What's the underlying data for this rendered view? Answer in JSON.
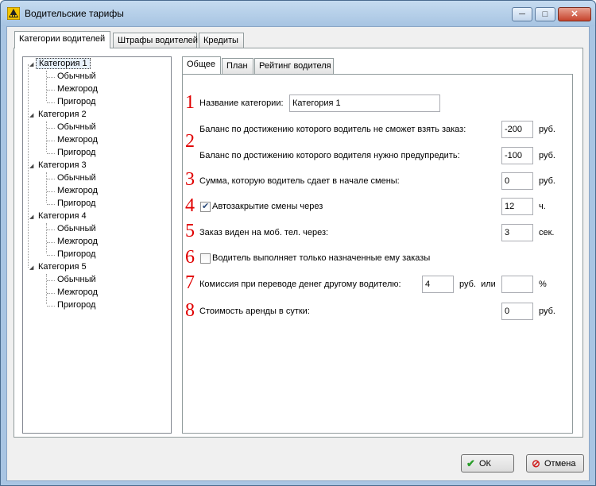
{
  "window": {
    "title": "Водительские тарифы",
    "controls": {
      "minimize": "─",
      "maximize": "□",
      "close": "✕"
    }
  },
  "outer_tabs": [
    "Категории водителей",
    "Штрафы водителей",
    "Кредиты"
  ],
  "tree": {
    "categories": [
      {
        "label": "Категория 1",
        "children": [
          "Обычный",
          "Межгород",
          "Пригород"
        ]
      },
      {
        "label": "Категория 2",
        "children": [
          "Обычный",
          "Межгород",
          "Пригород"
        ]
      },
      {
        "label": "Категория 3",
        "children": [
          "Обычный",
          "Межгород",
          "Пригород"
        ]
      },
      {
        "label": "Категория 4",
        "children": [
          "Обычный",
          "Межгород",
          "Пригород"
        ]
      },
      {
        "label": "Категория 5",
        "children": [
          "Обычный",
          "Межгород",
          "Пригород"
        ]
      }
    ],
    "selected": "Категория 1"
  },
  "inner_tabs": [
    "Общее",
    "План",
    "Рейтинг водителя"
  ],
  "general": {
    "numbers": [
      "1",
      "2",
      "3",
      "4",
      "5",
      "6",
      "7",
      "8"
    ],
    "category_name_label": "Название категории:",
    "category_name_value": "Категория 1",
    "balance_block_label": "Баланс по достижению которого водитель не сможет взять заказ:",
    "balance_block_value": "-200",
    "balance_warn_label": "Баланс по достижению которого водителя нужно предупредить:",
    "balance_warn_value": "-100",
    "shift_sum_label": "Сумма, которую водитель сдает в начале смены:",
    "shift_sum_value": "0",
    "auto_close_label": "Автозакрытие смены через",
    "auto_close_checked": true,
    "auto_close_value": "12",
    "auto_close_unit": "ч.",
    "order_visible_label": "Заказ виден на моб. тел. через:",
    "order_visible_value": "3",
    "order_visible_unit": "сек.",
    "assigned_only_label": "Водитель выполняет только назначенные ему заказы",
    "assigned_only_checked": false,
    "commission_label": "Комиссия при переводе денег другому водителю:",
    "commission_value": "4",
    "commission_mid": "руб.  или",
    "commission_percent_value": "",
    "commission_percent_unit": "%",
    "rent_label": "Стоимость аренды в сутки:",
    "rent_value": "0",
    "rub": "руб."
  },
  "buttons": {
    "ok": "ОК",
    "cancel": "Отмена"
  },
  "colors": {
    "annotation_red": "#e00000",
    "ok_green": "#2a9d2a",
    "cancel_red": "#d02020"
  }
}
